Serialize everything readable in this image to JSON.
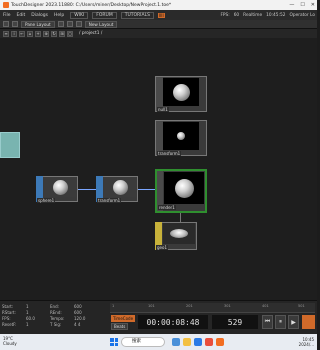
{
  "window": {
    "title": "TouchDesigner 2023.11880: C:/Users/miner/Desktop/NewProject.1.toe*",
    "minimize": "—",
    "maximize": "☐",
    "close": "✕"
  },
  "menubar": {
    "items": [
      "File",
      "Edit",
      "Dialogs",
      "Help"
    ],
    "tabs": [
      "WIKI",
      "FORUM",
      "TUTORIALS"
    ],
    "badge": "IIII",
    "fps_label": "FPS:",
    "fps_value": "60",
    "perf_label": "Realtime",
    "time": "10:45:52",
    "mode": "Operator Lo"
  },
  "panebar": {
    "pane_layout": "Pane Layout",
    "new_layout": "New Layout"
  },
  "navbar": {
    "buttons": [
      "≡",
      "i",
      "←",
      "⌂",
      "+",
      "⊕",
      "↻",
      "⊞",
      "◻"
    ],
    "path": "/ project1 /"
  },
  "nodes": {
    "null1": "null1",
    "transform1": "transform1",
    "sphere1": "sphere1",
    "transformB": "transform1",
    "out": "render1",
    "geo": "geo1",
    "cam": "camera1"
  },
  "timeline": {
    "start_label": "Start:",
    "start_value": "1",
    "end_label": "End:",
    "end_value": "600",
    "rstart_label": "RStart:",
    "rstart_value": "1",
    "rend_label": "REnd:",
    "rend_value": "600",
    "fps_label": "FPS:",
    "fps_value": "60.0",
    "tempo_label": "Tempo:",
    "tempo_value": "120.0",
    "reset_label": "ResetF:",
    "reset_value": "1",
    "tsig_label": "T Sig:",
    "tsig_value": "4  4",
    "ruler": [
      "1",
      "101",
      "201",
      "301",
      "401",
      "501"
    ],
    "timecode_btn": "TimeCode",
    "beats_btn": "Beats",
    "timecode": "00:00:08:48",
    "frame": "529",
    "transport": [
      "⏮",
      "⏸",
      "▶"
    ]
  },
  "taskbar": {
    "weather_temp": "19°C",
    "weather_desc": "Cloudy",
    "search_placeholder": "搜索",
    "tray_time": "10:45",
    "tray_date": "2024/..."
  },
  "colors": {
    "accent": "#d06a2a",
    "wire": "#7aa6ff",
    "selected": "#2f8f2f"
  }
}
